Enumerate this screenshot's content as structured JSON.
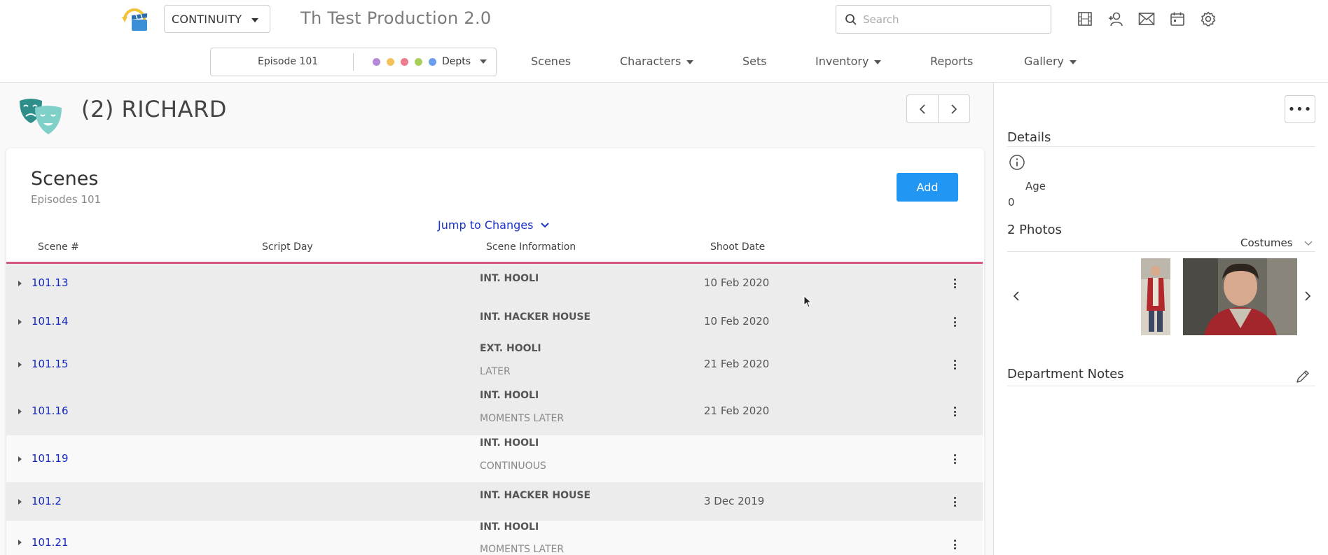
{
  "header": {
    "mode": "CONTINUITY",
    "production_title": "Th Test Production 2.0",
    "search_placeholder": "Search",
    "icons": [
      "film-icon",
      "add-user-icon",
      "mail-icon",
      "calendar-icon",
      "gear-icon"
    ]
  },
  "subnav": {
    "episode": "Episode 101",
    "depts_label": "Depts",
    "dept_colors": [
      "#b48ad8",
      "#f5c15a",
      "#f07b8c",
      "#a9cf5b",
      "#6c9ef0"
    ],
    "items": [
      {
        "label": "Scenes",
        "dropdown": false
      },
      {
        "label": "Characters",
        "dropdown": true
      },
      {
        "label": "Sets",
        "dropdown": false
      },
      {
        "label": "Inventory",
        "dropdown": true
      },
      {
        "label": "Reports",
        "dropdown": false
      },
      {
        "label": "Gallery",
        "dropdown": true
      }
    ]
  },
  "character": {
    "title": "(2) RICHARD"
  },
  "scenes": {
    "title": "Scenes",
    "subtitle": "Episodes 101",
    "add_label": "Add",
    "jump_label": "Jump to Changes",
    "columns": [
      "Scene #",
      "Script Day",
      "Scene Information",
      "Shoot Date"
    ],
    "rows": [
      {
        "num": "101.13",
        "info1": "INT. HOOLI",
        "info2": "",
        "date": "10 Feb 2020"
      },
      {
        "num": "101.14",
        "info1": "INT. HACKER HOUSE",
        "info2": "",
        "date": "10 Feb 2020"
      },
      {
        "num": "101.15",
        "info1": "EXT. HOOLI",
        "info2": "LATER",
        "date": "21 Feb 2020"
      },
      {
        "num": "101.16",
        "info1": "INT. HOOLI",
        "info2": "MOMENTS LATER",
        "date": "21 Feb 2020"
      },
      {
        "num": "101.19",
        "info1": "INT. HOOLI",
        "info2": "CONTINUOUS",
        "date": ""
      },
      {
        "num": "101.2",
        "info1": "INT. HACKER HOUSE",
        "info2": "",
        "date": "3 Dec 2019"
      },
      {
        "num": "101.21",
        "info1": "INT. HOOLI",
        "info2": "MOMENTS LATER",
        "date": ""
      }
    ]
  },
  "details": {
    "title": "Details",
    "age_label": "Age",
    "age_value": "0",
    "photos_title": "2 Photos",
    "photos_filter": "Costumes",
    "notes_title": "Department Notes"
  }
}
